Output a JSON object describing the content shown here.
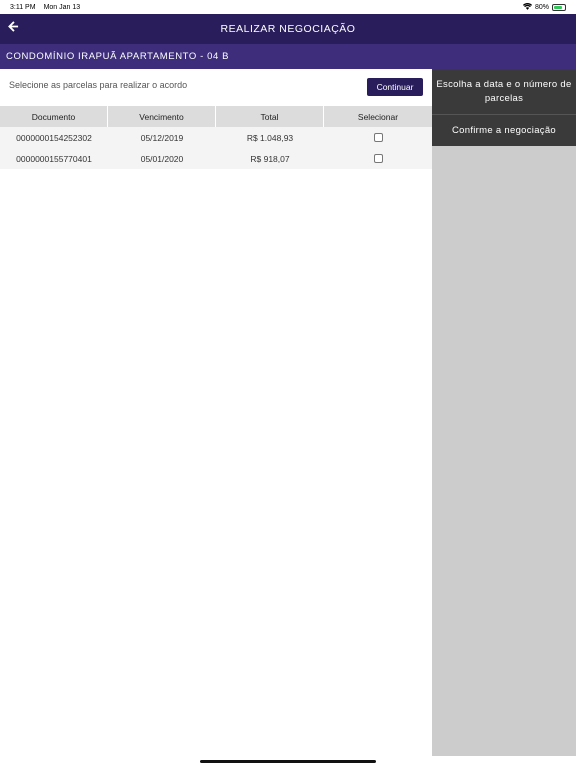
{
  "status_bar": {
    "time": "3:11 PM",
    "date": "Mon Jan 13",
    "battery": "80%",
    "battery_level": 0.8
  },
  "nav": {
    "title": "REALIZAR NEGOCIAÇÃO",
    "back_icon": "arrow-left-icon"
  },
  "subheader": {
    "unit": "CONDOMÍNIO IRAPUÃ APARTAMENTO - 04 B"
  },
  "main": {
    "instruction": "Selecione as parcelas para realizar o acordo",
    "continue_label": "Continuar",
    "table": {
      "headers": [
        "Documento",
        "Vencimento",
        "Total",
        "Selecionar"
      ],
      "rows": [
        {
          "documento": "0000000154252302",
          "vencimento": "05/12/2019",
          "total": "R$ 1.048,93",
          "selected": false
        },
        {
          "documento": "0000000155770401",
          "vencimento": "05/01/2020",
          "total": "R$ 918,07",
          "selected": false
        }
      ]
    }
  },
  "steps": [
    {
      "label": "Escolha a data e o número de parcelas"
    },
    {
      "label": "Confirme a negociação"
    }
  ],
  "colors": {
    "nav_bg": "#2a1d5c",
    "subheader_bg": "#3d2d7a",
    "button_bg": "#2a1d5c",
    "step_bg": "#3a3a3a",
    "side_bg": "#cccccc",
    "battery": "#34c759"
  }
}
